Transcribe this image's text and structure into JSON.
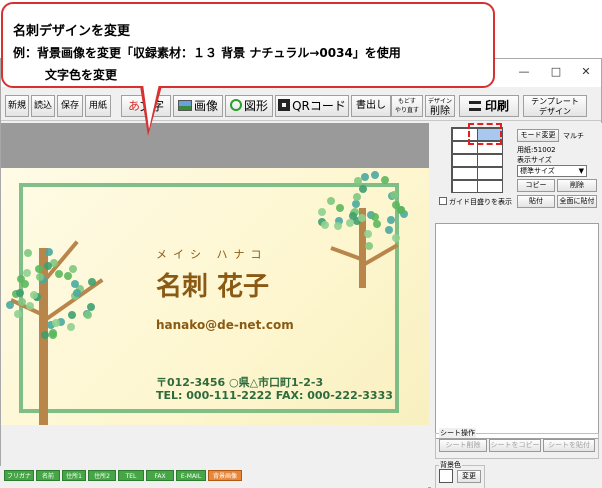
{
  "callout": {
    "title": "名刺デザインを変更",
    "line1": "例：背景画像を変更「収録素材：１３ 背景 ナチュラル→0034」を使用",
    "line2": "文字色を変更"
  },
  "window": {
    "minimize": "—",
    "maximize": "□",
    "close": "✕"
  },
  "toolbar": {
    "new": "新規",
    "open": "読込",
    "save": "保存",
    "paper": "用紙",
    "text_prefix": "あ",
    "text": "文字",
    "image": "画像",
    "shape": "図形",
    "qr": "QRコード",
    "write": "書出し",
    "undo": "もどす",
    "redo": "やり直す",
    "design_top": "デザイン",
    "delete": "削除",
    "print": "印刷",
    "template_1": "テンプレート",
    "template_2": "デザイン"
  },
  "card": {
    "kana": "メイシ ハナコ",
    "name": "名刺 花子",
    "email": "hanako@de-net.com",
    "address": "〒012-3456 ○県△市口町1-2-3",
    "tel": "TEL: 000-111-2222  FAX: 000-222-3333"
  },
  "panel": {
    "mode_change": "モード変更",
    "multi": "マルチ",
    "paper": "用紙:51002",
    "display_size_label": "表示サイズ",
    "display_size": "標準サイズ",
    "copy": "コピー",
    "delete": "削除",
    "paste": "貼付",
    "paste_all": "全面に貼付",
    "guide": "ガイド目盛りを表示",
    "sheet_ops": "シート操作",
    "sheet_delete": "シート削除",
    "sheet_copy": "シートをコピー",
    "sheet_paste": "シートを貼付",
    "bg_color": "背景色",
    "bg_change": "変更"
  },
  "fields": [
    {
      "label": "フリガナ",
      "color": "green"
    },
    {
      "label": "名前",
      "color": "green"
    },
    {
      "label": "住所1",
      "color": "green"
    },
    {
      "label": "住所2",
      "color": "green"
    },
    {
      "label": "TEL",
      "color": "green"
    },
    {
      "label": "FAX",
      "color": "green"
    },
    {
      "label": "E-MAIL",
      "color": "green"
    },
    {
      "label": "背景画像",
      "color": "orange"
    }
  ]
}
